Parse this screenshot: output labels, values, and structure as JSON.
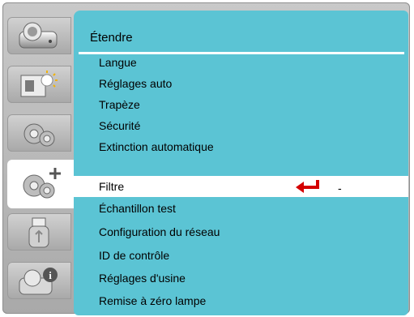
{
  "menu": {
    "title": "Étendre",
    "items": [
      {
        "label": "Langue"
      },
      {
        "label": "Réglages auto"
      },
      {
        "label": "Trapèze"
      },
      {
        "label": "Sécurité"
      },
      {
        "label": "Extinction automatique"
      },
      {
        "label": "Filtre",
        "value": "-",
        "selected": true
      },
      {
        "label": "Échantillon test"
      },
      {
        "label": "Configuration du réseau"
      },
      {
        "label": "ID de contrôle"
      },
      {
        "label": "Réglages d'usine"
      },
      {
        "label": "Remise à zéro lampe"
      }
    ]
  },
  "tabs": [
    {
      "icon": "projector-icon"
    },
    {
      "icon": "picture-adjust-icon"
    },
    {
      "icon": "settings-gear-icon"
    },
    {
      "icon": "extended-settings-icon",
      "active": true
    },
    {
      "icon": "usb-icon"
    },
    {
      "icon": "info-icon"
    }
  ],
  "colors": {
    "panel": "#5bc4d4",
    "selected_row": "#ffffff",
    "arrow": "#d40000"
  }
}
